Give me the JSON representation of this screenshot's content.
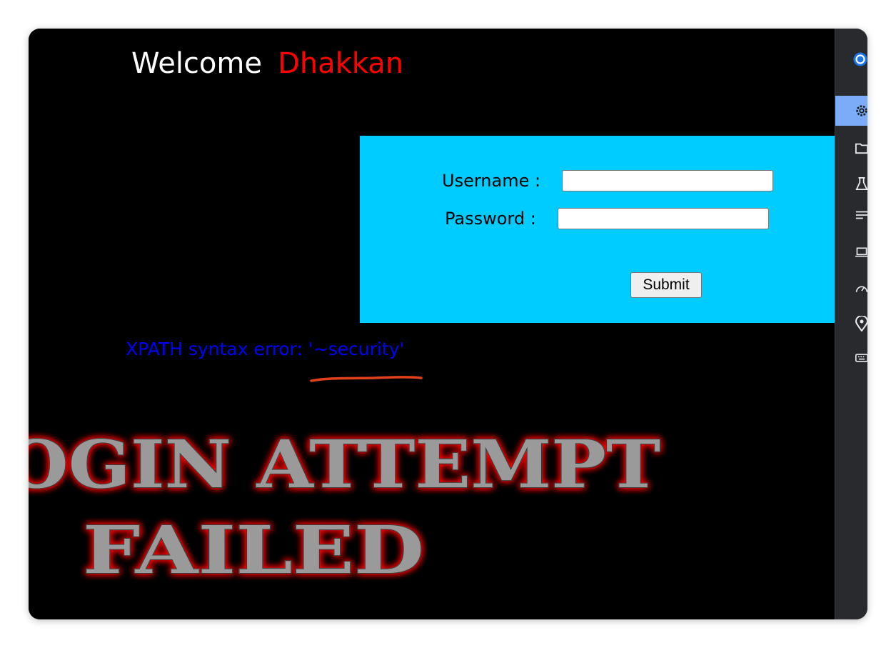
{
  "header": {
    "welcome_label": "Welcome",
    "username": "Dhakkan"
  },
  "login_form": {
    "username_label": "Username :",
    "username_value": "",
    "password_label": "Password :",
    "password_value": "",
    "submit_label": "Submit"
  },
  "error": {
    "message": "XPATH syntax error: '~security'"
  },
  "banner": {
    "line1": "LOGIN ATTEMPT",
    "line2": "FAILED"
  },
  "colors": {
    "page_bg": "#000000",
    "form_bg": "#00ccff",
    "username_color": "#ff0000",
    "error_color": "#0000ff",
    "banner_glow": "#ff0000",
    "annotation_underline": "#e0401a"
  },
  "devtools_sidebar": {
    "icons": [
      "chrome-icon",
      "gear-icon",
      "folder-icon",
      "flask-icon",
      "list-icon",
      "laptop-icon",
      "gauge-icon",
      "location-pin-icon",
      "keyboard-icon"
    ],
    "active_icon": "gear-icon"
  }
}
